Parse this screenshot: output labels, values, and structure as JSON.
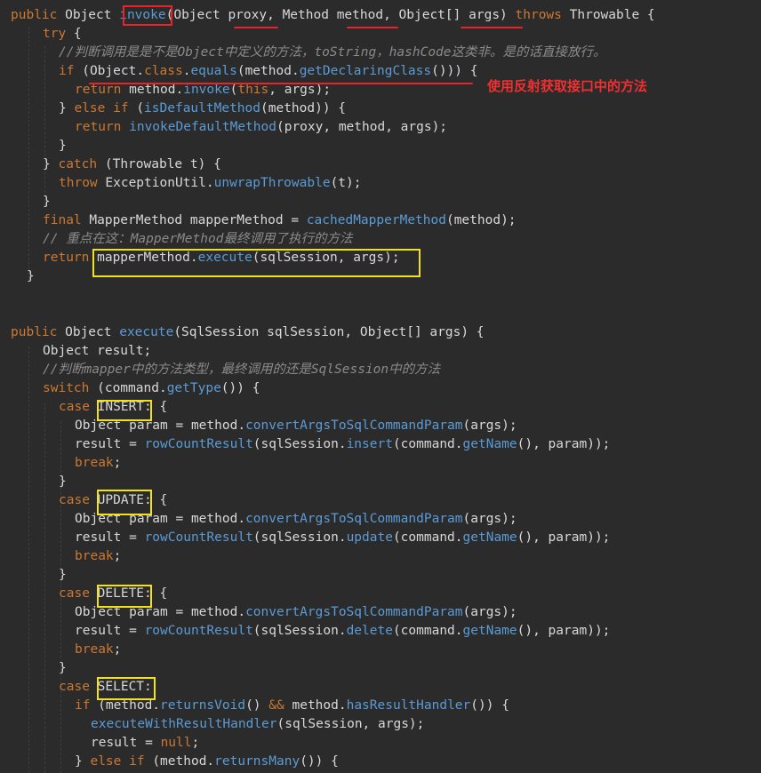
{
  "code_lines": [
    [
      [
        "kw",
        "public "
      ],
      [
        "t",
        "Object "
      ],
      [
        "fn",
        "invoke"
      ],
      [
        "t",
        "(Object "
      ],
      [
        "t",
        "proxy"
      ],
      [
        "t",
        ", Method "
      ],
      [
        "t",
        "method"
      ],
      [
        "t",
        ", Object"
      ],
      [
        "t",
        "[] "
      ],
      [
        "t",
        "args"
      ],
      [
        "t",
        ") "
      ],
      [
        "kw",
        "throws "
      ],
      [
        "t",
        "Throwable {"
      ]
    ],
    [
      [
        "kw",
        "try "
      ],
      [
        "t",
        "{"
      ]
    ],
    [
      [
        "cm",
        "//判断调用是是不是Object中定义的方法，toString，hashCode这类非。是的话直接放行。"
      ]
    ],
    [
      [
        "kw",
        "if "
      ],
      [
        "t",
        "("
      ],
      [
        "t",
        "Object"
      ],
      [
        "t",
        "."
      ],
      [
        "kw",
        "class"
      ],
      [
        "t",
        "."
      ],
      [
        "fn",
        "equals"
      ],
      [
        "t",
        "("
      ],
      [
        "t",
        "method"
      ],
      [
        "t",
        "."
      ],
      [
        "fn",
        "getDeclaringClass"
      ],
      [
        "t",
        "())) {"
      ]
    ],
    [
      [
        "kw",
        "return "
      ],
      [
        "t",
        "method."
      ],
      [
        "fn",
        "invoke"
      ],
      [
        "t",
        "("
      ],
      [
        "kw",
        "this"
      ],
      [
        "t",
        ", args);"
      ]
    ],
    [
      [
        "t",
        "} "
      ],
      [
        "kw",
        "else if "
      ],
      [
        "t",
        "("
      ],
      [
        "fn",
        "isDefaultMethod"
      ],
      [
        "t",
        "(method)) {"
      ]
    ],
    [
      [
        "kw",
        "return "
      ],
      [
        "fn",
        "invokeDefaultMethod"
      ],
      [
        "t",
        "(proxy, method, args);"
      ]
    ],
    [
      [
        "t",
        "}"
      ]
    ],
    [
      [
        "t",
        "} "
      ],
      [
        "kw",
        "catch "
      ],
      [
        "t",
        "(Throwable t) {"
      ]
    ],
    [
      [
        "kw",
        "throw "
      ],
      [
        "t",
        "ExceptionUtil."
      ],
      [
        "fn",
        "unwrapThrowable"
      ],
      [
        "t",
        "(t);"
      ]
    ],
    [
      [
        "t",
        "}"
      ]
    ],
    [
      [
        "kw",
        "final "
      ],
      [
        "t",
        "MapperMethod mapperMethod = "
      ],
      [
        "fn",
        "cachedMapperMethod"
      ],
      [
        "t",
        "(method);"
      ]
    ],
    [
      [
        "cm",
        "// 重点在这：MapperMethod最终调用了执行的方法"
      ]
    ],
    [
      [
        "kw",
        "return "
      ],
      [
        "t",
        "mapperMethod."
      ],
      [
        "fn",
        "execute"
      ],
      [
        "t",
        "(sqlSession, args);"
      ]
    ],
    [
      [
        "t",
        "}"
      ]
    ],
    [],
    [],
    [
      [
        "kw",
        "public "
      ],
      [
        "t",
        "Object "
      ],
      [
        "fn",
        "execute"
      ],
      [
        "t",
        "(SqlSession sqlSession, Object[] args) {"
      ]
    ],
    [
      [
        "t",
        "Object result;"
      ]
    ],
    [
      [
        "cm",
        "//判断mapper中的方法类型，最终调用的还是SqlSession中的方法"
      ]
    ],
    [
      [
        "kw",
        "switch "
      ],
      [
        "t",
        "(command."
      ],
      [
        "fn",
        "getType"
      ],
      [
        "t",
        "()) {"
      ]
    ],
    [
      [
        "kw",
        "case "
      ],
      [
        "t",
        "INSERT"
      ],
      [
        "t",
        ": {"
      ]
    ],
    [
      [
        "t",
        "Object param = method."
      ],
      [
        "fn",
        "convertArgsToSqlCommandParam"
      ],
      [
        "t",
        "(args);"
      ]
    ],
    [
      [
        "t",
        "result = "
      ],
      [
        "fn",
        "rowCountResult"
      ],
      [
        "t",
        "(sqlSession."
      ],
      [
        "fn",
        "insert"
      ],
      [
        "t",
        "(command."
      ],
      [
        "fn",
        "getName"
      ],
      [
        "t",
        "(), param));"
      ]
    ],
    [
      [
        "kw",
        "break"
      ],
      [
        "t",
        ";"
      ]
    ],
    [
      [
        "t",
        "}"
      ]
    ],
    [
      [
        "kw",
        "case "
      ],
      [
        "t",
        "UPDATE"
      ],
      [
        "t",
        ": {"
      ]
    ],
    [
      [
        "t",
        "Object param = method."
      ],
      [
        "fn",
        "convertArgsToSqlCommandParam"
      ],
      [
        "t",
        "(args);"
      ]
    ],
    [
      [
        "t",
        "result = "
      ],
      [
        "fn",
        "rowCountResult"
      ],
      [
        "t",
        "(sqlSession."
      ],
      [
        "fn",
        "update"
      ],
      [
        "t",
        "(command."
      ],
      [
        "fn",
        "getName"
      ],
      [
        "t",
        "(), param));"
      ]
    ],
    [
      [
        "kw",
        "break"
      ],
      [
        "t",
        ";"
      ]
    ],
    [
      [
        "t",
        "}"
      ]
    ],
    [
      [
        "kw",
        "case "
      ],
      [
        "t",
        "DELETE"
      ],
      [
        "t",
        ": {"
      ]
    ],
    [
      [
        "t",
        "Object param = method."
      ],
      [
        "fn",
        "convertArgsToSqlCommandParam"
      ],
      [
        "t",
        "(args);"
      ]
    ],
    [
      [
        "t",
        "result = "
      ],
      [
        "fn",
        "rowCountResult"
      ],
      [
        "t",
        "(sqlSession."
      ],
      [
        "fn",
        "delete"
      ],
      [
        "t",
        "(command."
      ],
      [
        "fn",
        "getName"
      ],
      [
        "t",
        "(), param));"
      ]
    ],
    [
      [
        "kw",
        "break"
      ],
      [
        "t",
        ";"
      ]
    ],
    [
      [
        "t",
        "}"
      ]
    ],
    [
      [
        "kw",
        "case "
      ],
      [
        "t",
        "SELECT"
      ],
      [
        "t",
        ":"
      ]
    ],
    [
      [
        "kw",
        "if "
      ],
      [
        "t",
        "(method."
      ],
      [
        "fn",
        "returnsVoid"
      ],
      [
        "t",
        "() "
      ],
      [
        "kw",
        "&& "
      ],
      [
        "t",
        "method."
      ],
      [
        "fn",
        "hasResultHandler"
      ],
      [
        "t",
        "()) {"
      ]
    ],
    [
      [
        "fn",
        "executeWithResultHandler"
      ],
      [
        "t",
        "(sqlSession, args);"
      ]
    ],
    [
      [
        "t",
        "result = "
      ],
      [
        "kw",
        "null"
      ],
      [
        "t",
        ";"
      ]
    ],
    [
      [
        "t",
        "} "
      ],
      [
        "kw",
        "else if "
      ],
      [
        "t",
        "(method."
      ],
      [
        "fn",
        "returnsMany"
      ],
      [
        "t",
        "()) {"
      ]
    ]
  ],
  "annotation": {
    "note": "使用反射获取接口中的方法"
  },
  "colors": {
    "background": "#2b2b2b",
    "keyword": "#cc7832",
    "comment": "#8a8a8a",
    "method_call": "#5b9bd5",
    "text": "#d8d8d8",
    "annotation_red": "#e8242b",
    "annotation_yellow": "#f2e21a"
  }
}
